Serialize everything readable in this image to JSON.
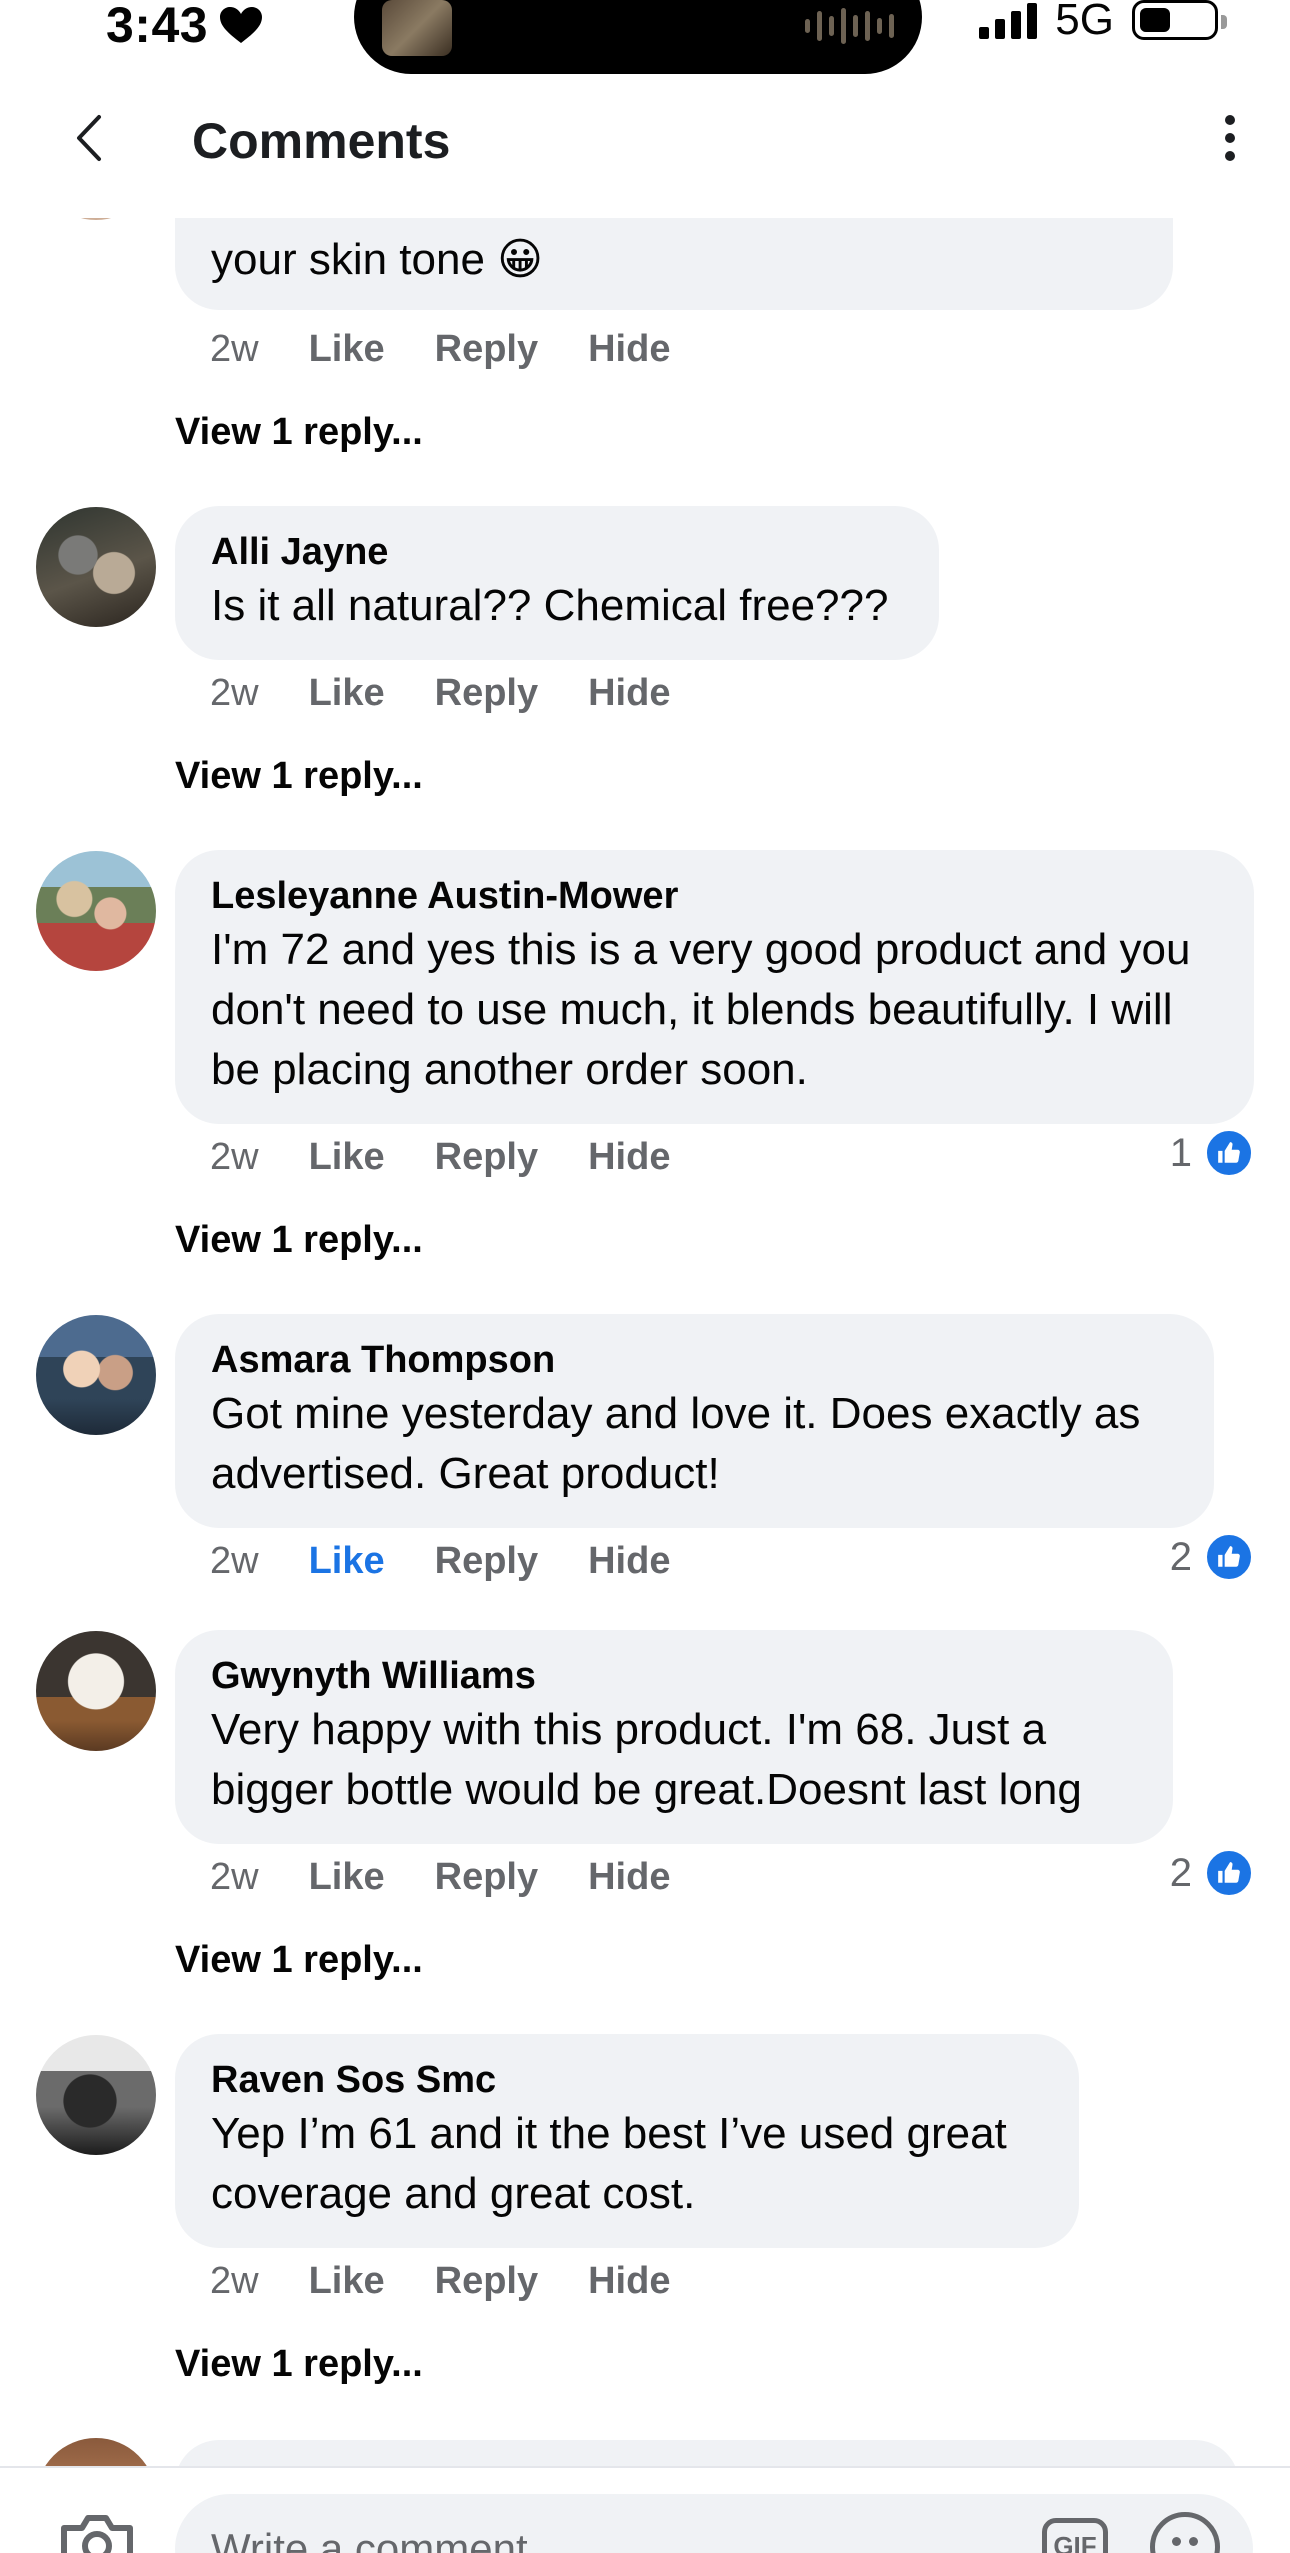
{
  "status_bar": {
    "time": "3:43",
    "network": "5G"
  },
  "header": {
    "title": "Comments"
  },
  "top_comment": {
    "text": "your skin tone 😀",
    "time": "2w",
    "like": "Like",
    "reply": "Reply",
    "hide": "Hide",
    "view_replies": "View 1 reply..."
  },
  "comments": [
    {
      "author": "Alli Jayne",
      "text": "Is it all natural?? Chemical free???",
      "time": "2w",
      "like": "Like",
      "reply": "Reply",
      "hide": "Hide",
      "view_replies": "View 1 reply..."
    },
    {
      "author": "Lesleyanne Austin-Mower",
      "text": "I'm 72 and yes this is a very good product and you don't need to use much, it blends beautifully. I will be placing another order soon.",
      "time": "2w",
      "like": "Like",
      "reply": "Reply",
      "hide": "Hide",
      "reaction_count": "1",
      "view_replies": "View 1 reply..."
    },
    {
      "author": "Asmara Thompson",
      "text": "Got mine yesterday and love it. Does exactly as advertised. Great product!",
      "time": "2w",
      "like": "Like",
      "liked": true,
      "reply": "Reply",
      "hide": "Hide",
      "reaction_count": "2"
    },
    {
      "author": "Gwynyth Williams",
      "text": "Very happy with this product. I'm 68. Just a bigger bottle would be great.Doesnt last long",
      "time": "2w",
      "like": "Like",
      "reply": "Reply",
      "hide": "Hide",
      "reaction_count": "2",
      "view_replies": "View 1 reply..."
    },
    {
      "author": "Raven Sos Smc",
      "text": "Yep I’m 61 and it the best I’ve used great coverage and great cost.",
      "time": "2w",
      "like": "Like",
      "reply": "Reply",
      "hide": "Hide",
      "view_replies": "View 1 reply..."
    }
  ],
  "composer": {
    "placeholder": "Write a comment...",
    "gif_label": "GIF"
  },
  "colors": {
    "accent": "#1b74e4",
    "bubble": "#f0f2f5",
    "secondary_text": "#65676b"
  },
  "icons": [
    "heart-icon",
    "signal-icon",
    "battery-icon",
    "back-icon",
    "more-icon",
    "like-badge-icon",
    "camera-icon",
    "gif-icon",
    "emoji-icon"
  ]
}
